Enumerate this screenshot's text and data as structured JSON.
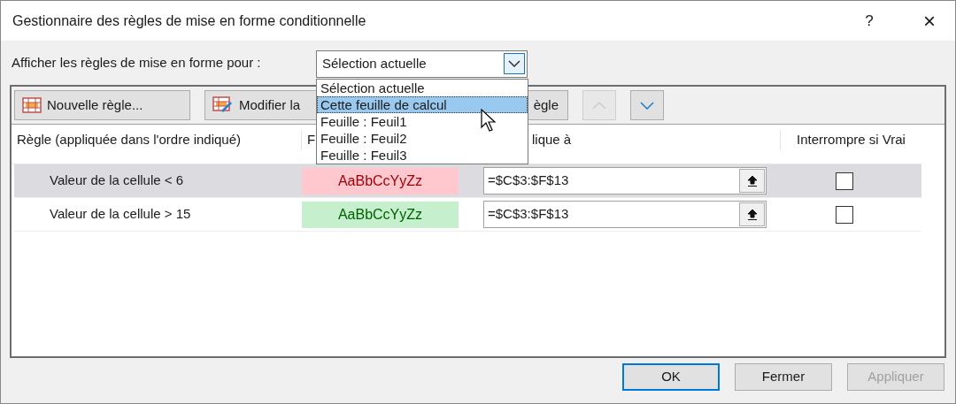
{
  "window": {
    "title": "Gestionnaire des règles de mise en forme conditionnelle",
    "help": "?",
    "close": "×"
  },
  "scope": {
    "label": "Afficher les règles de mise en forme pour :",
    "value": "Sélection actuelle",
    "expanded": true,
    "options": [
      {
        "label": "Sélection actuelle",
        "highlighted": false
      },
      {
        "label": "Cette feuille de calcul",
        "highlighted": true
      },
      {
        "label": "Feuille : Feuil1",
        "highlighted": false
      },
      {
        "label": "Feuille : Feuil2",
        "highlighted": false
      },
      {
        "label": "Feuille : Feuil3",
        "highlighted": false
      }
    ]
  },
  "toolbar": [
    {
      "kind": "new",
      "label": "Nouvelle règle...",
      "disabled": false
    },
    {
      "kind": "edit",
      "label": "Modifier la",
      "disabled": false
    },
    {
      "kind": "delete",
      "label": "ègle",
      "disabled": false
    },
    {
      "kind": "up",
      "disabled": true
    },
    {
      "kind": "down",
      "disabled": false
    }
  ],
  "table": {
    "columns": [
      "Règle (appliquée dans l'ordre indiqué)",
      "F",
      "lique à",
      "Interrompre si Vrai"
    ],
    "rows": [
      {
        "rule": "Valeur de la cellule < 6",
        "format": {
          "text": "AaBbCcYyZz",
          "kind": "bad"
        },
        "applies_to": "=$C$3:$F$13",
        "stop_if_true": false,
        "selected": true
      },
      {
        "rule": "Valeur de la cellule > 15",
        "format": {
          "text": "AaBbCcYyZz",
          "kind": "good"
        },
        "applies_to": "=$C$3:$F$13",
        "stop_if_true": false,
        "selected": false
      }
    ]
  },
  "buttons": [
    {
      "label": "OK",
      "default": true,
      "disabled": false
    },
    {
      "label": "Fermer",
      "default": false,
      "disabled": false
    },
    {
      "label": "Appliquer",
      "default": false,
      "disabled": true
    }
  ]
}
